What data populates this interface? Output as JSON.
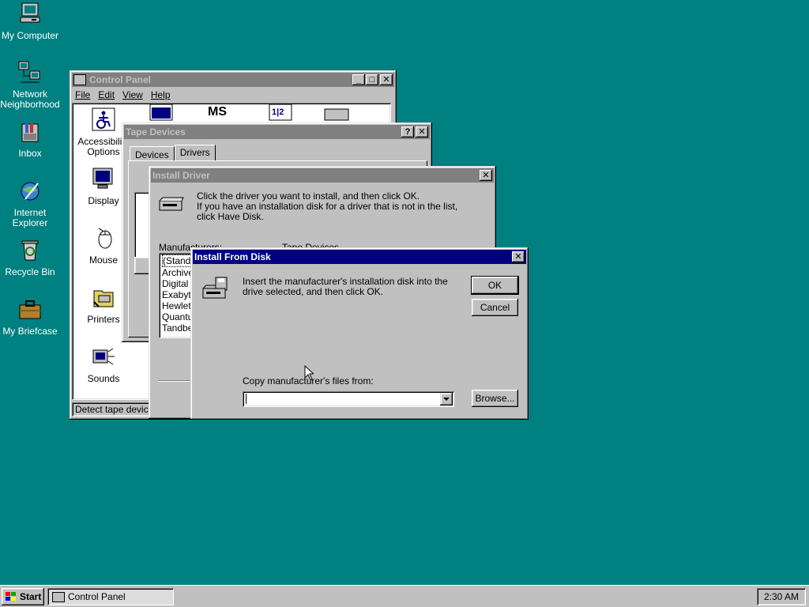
{
  "desktop": {
    "icons": [
      {
        "label": "My Computer"
      },
      {
        "label": "Network Neighborhood"
      },
      {
        "label": "Inbox"
      },
      {
        "label": "Internet Explorer"
      },
      {
        "label": "Recycle Bin"
      },
      {
        "label": "My Briefcase"
      }
    ]
  },
  "control_panel": {
    "title": "Control Panel",
    "menu": [
      "File",
      "Edit",
      "View",
      "Help"
    ],
    "items": [
      "Accessibility Options",
      "Display",
      "Mouse",
      "Printers",
      "Sounds"
    ],
    "status": "Detect tape devices"
  },
  "tape_devices": {
    "title": "Tape Devices",
    "tabs": [
      "Devices",
      "Drivers"
    ]
  },
  "install_driver": {
    "title": "Install Driver",
    "instructions_line1": "Click the driver you want to install, and then click OK.",
    "instructions_line2": "If you have an installation disk for a driver that is not in the list, click Have Disk.",
    "manufacturers_label": "Manufacturers:",
    "devices_label": "Tape Devices",
    "manufacturers": [
      "(Standa",
      "Archive",
      "Digital",
      "Exabyte",
      "Hewlet",
      "Quantu",
      "Tandbe"
    ]
  },
  "install_from_disk": {
    "title": "Install From Disk",
    "message": "Insert the manufacturer's installation disk into the drive selected, and then click OK.",
    "ok_label": "OK",
    "cancel_label": "Cancel",
    "copy_label": "Copy manufacturer's files from:",
    "path_value": "",
    "browse_label": "Browse..."
  },
  "taskbar": {
    "start_label": "Start",
    "task_label": "Control Panel",
    "clock": "2:30 AM"
  },
  "colors": {
    "desktop": "#008080",
    "active_title": "#000080",
    "inactive_title": "#808080",
    "face": "#c0c0c0"
  }
}
